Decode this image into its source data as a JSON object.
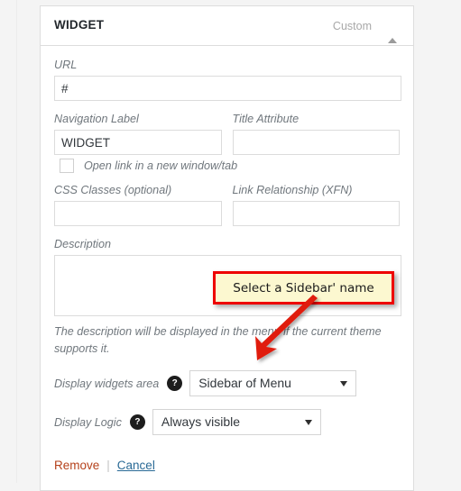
{
  "panel": {
    "title": "WIDGET",
    "type_label": "Custom",
    "toggle_icon": "collapse-triangle-up-icon"
  },
  "fields": {
    "url": {
      "label": "URL",
      "value": "#"
    },
    "navigation_label": {
      "label": "Navigation Label",
      "value": "WIDGET"
    },
    "title_attribute": {
      "label": "Title Attribute",
      "value": ""
    },
    "open_new_tab": {
      "label": "Open link in a new window/tab",
      "checked": false
    },
    "css_classes": {
      "label": "CSS Classes (optional)",
      "value": ""
    },
    "link_relationship": {
      "label": "Link Relationship (XFN)",
      "value": ""
    },
    "description": {
      "label": "Description",
      "value": "",
      "help": "The description will be displayed in the menu if the current theme supports it."
    },
    "display_widgets_area": {
      "label": "Display widgets area",
      "help_icon": "question-mark-icon",
      "selected": "Sidebar of Menu"
    },
    "display_logic": {
      "label": "Display Logic",
      "help_icon": "question-mark-icon",
      "selected": "Always visible"
    }
  },
  "actions": {
    "remove_label": "Remove",
    "separator": "|",
    "cancel_label": "Cancel"
  },
  "annotation": {
    "callout_text": "Select a Sidebar' name",
    "callout_border_color": "#ee0000",
    "callout_background_color": "#fcf8d0",
    "arrow_color": "#e01b0f",
    "arrow_icon": "red-pointer-arrow-icon"
  },
  "colors": {
    "panel_border": "#dddddd",
    "label_text": "#70777d",
    "remove_link": "#b5411b",
    "cancel_link": "#2a6a96",
    "page_background": "#f4f4f4"
  }
}
